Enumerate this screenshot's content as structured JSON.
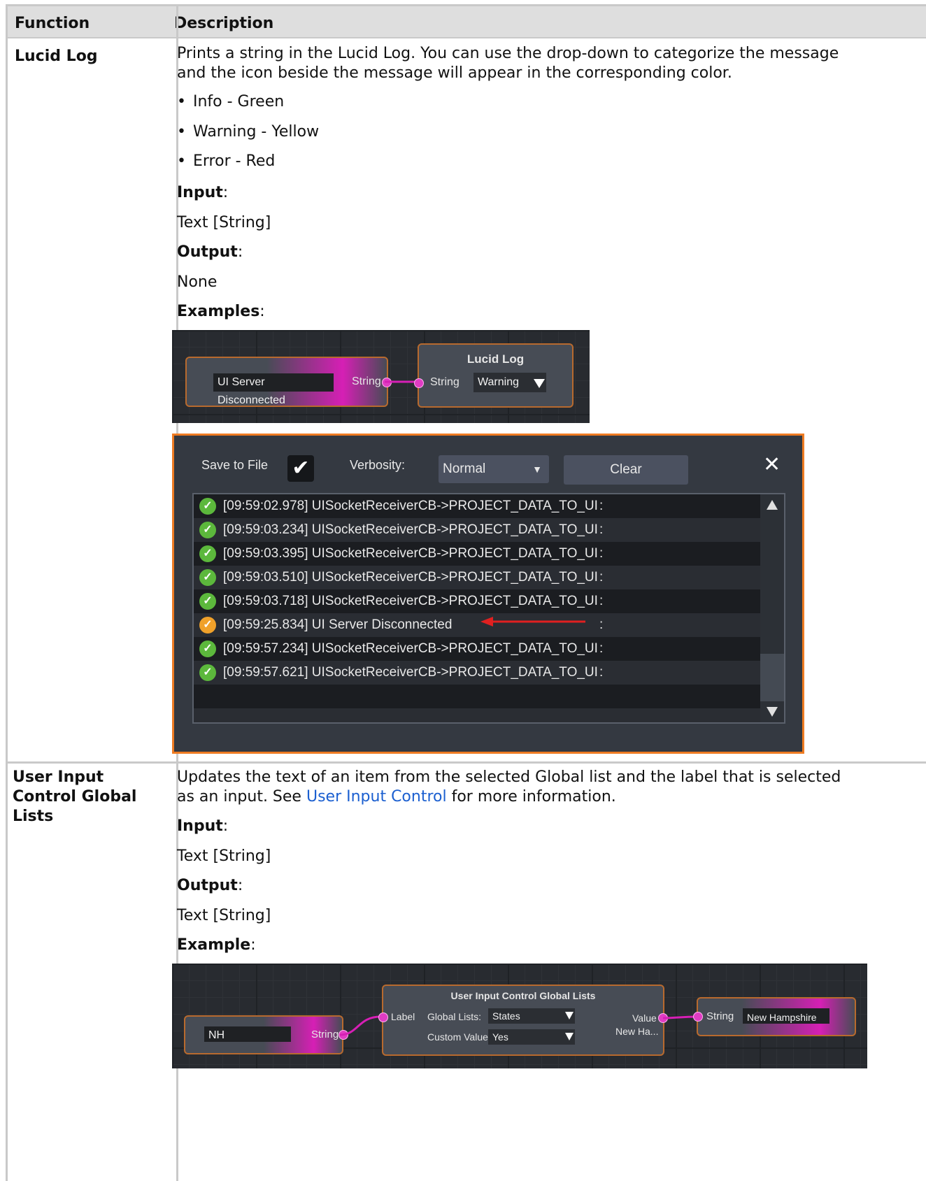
{
  "table": {
    "headers": {
      "function": "Function",
      "description": "Description"
    },
    "rows": [
      {
        "function": "Lucid Log",
        "description_line1": "Prints a string in the Lucid Log. You can use the drop-down to categorize the message",
        "description_line2": "and the icon beside the message will appear in the corresponding color.",
        "bullets": [
          "Info - Green",
          "Warning - Yellow",
          "Error - Red"
        ],
        "input_label": "Input",
        "input_value": "Text [String]",
        "output_label": "Output",
        "output_value": "None",
        "examples_label": "Examples",
        "example_graph": {
          "source_text": "UI Server Disconnected",
          "source_port": "String",
          "node_title": "Lucid Log",
          "node_port": "String",
          "dropdown_value": "Warning"
        },
        "log_window": {
          "save_to_file": "Save to File",
          "save_checked": true,
          "verbosity_label": "Verbosity:",
          "verbosity_value": "Normal",
          "clear_label": "Clear",
          "close_glyph": "✕",
          "entries": [
            {
              "level": "info",
              "text": "[09:59:02.978] UISocketReceiverCB->PROJECT_DATA_TO_UI",
              "suffix": ":"
            },
            {
              "level": "info",
              "text": "[09:59:03.234] UISocketReceiverCB->PROJECT_DATA_TO_UI",
              "suffix": ":"
            },
            {
              "level": "info",
              "text": "[09:59:03.395] UISocketReceiverCB->PROJECT_DATA_TO_UI",
              "suffix": ":"
            },
            {
              "level": "info",
              "text": "[09:59:03.510] UISocketReceiverCB->PROJECT_DATA_TO_UI",
              "suffix": ":"
            },
            {
              "level": "info",
              "text": "[09:59:03.718] UISocketReceiverCB->PROJECT_DATA_TO_UI",
              "suffix": ":"
            },
            {
              "level": "warning",
              "text": "[09:59:25.834] UI Server Disconnected",
              "suffix": ":"
            },
            {
              "level": "info",
              "text": "[09:59:57.234] UISocketReceiverCB->PROJECT_DATA_TO_UI",
              "suffix": ":"
            },
            {
              "level": "info",
              "text": "[09:59:57.621] UISocketReceiverCB->PROJECT_DATA_TO_UI",
              "suffix": ":"
            }
          ],
          "colors": {
            "info": "#5cb83c",
            "warning": "#f0a12a",
            "arrow": "#e02020"
          }
        }
      },
      {
        "function_line1": "User Input",
        "function_line2": "Control Global",
        "function_line3": "Lists",
        "description_line1": "Updates the text of an item from the selected Global list and the label that is selected",
        "description_pre": "as an input. See ",
        "description_link": "User Input Control",
        "description_post": " for more information.",
        "input_label": "Input",
        "input_value": "Text [String]",
        "output_label": "Output",
        "output_value": "Text [String]",
        "example_label": "Example",
        "example_graph": {
          "source_text": "NH",
          "source_port": "String",
          "node_title": "User Input Control Global Lists",
          "label_port": "Label",
          "global_lists_label": "Global Lists:",
          "global_lists_value": "States",
          "custom_value_label": "Custom Value",
          "custom_value_value": "Yes",
          "value_port": "Value",
          "value_preview": "New Ha...",
          "target_port": "String",
          "target_text": "New Hampshire"
        }
      }
    ]
  }
}
